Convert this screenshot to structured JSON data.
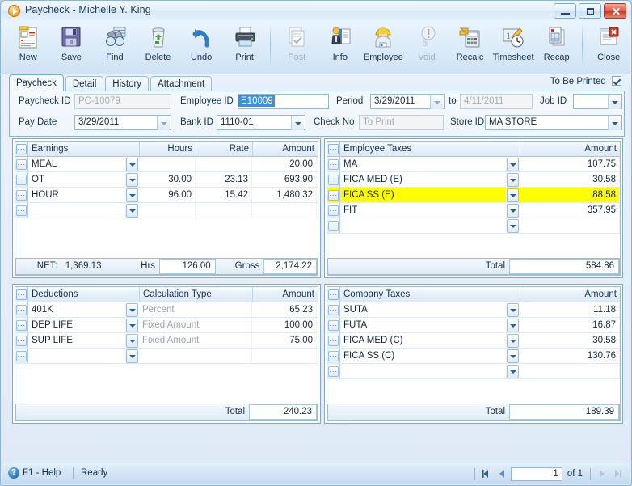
{
  "window": {
    "title": "Paycheck - Michelle Y. King",
    "icon": "play-circle-icon",
    "buttons": {
      "minimize": "minimize",
      "maximize": "maximize",
      "close": "close"
    }
  },
  "toolbar": [
    {
      "label": "New",
      "icon": "new-document-icon",
      "disabled": false
    },
    {
      "label": "Save",
      "icon": "floppy-disk-icon",
      "disabled": false
    },
    {
      "label": "Find",
      "icon": "binoculars-icon",
      "disabled": false
    },
    {
      "label": "Delete",
      "icon": "trash-can-icon",
      "disabled": false
    },
    {
      "label": "Undo",
      "icon": "undo-arrow-icon",
      "disabled": false
    },
    {
      "label": "Print",
      "icon": "printer-icon",
      "disabled": false
    },
    {
      "label": "Post",
      "icon": "post-pages-icon",
      "disabled": true
    },
    {
      "label": "Info",
      "icon": "info-person-icon",
      "disabled": false
    },
    {
      "label": "Employee",
      "icon": "employee-icon",
      "disabled": false
    },
    {
      "label": "Void",
      "icon": "void-dollar-icon",
      "disabled": true
    },
    {
      "label": "Recalc",
      "icon": "calculator-icon",
      "disabled": false
    },
    {
      "label": "Timesheet",
      "icon": "timesheet-clock-icon",
      "disabled": false
    },
    {
      "label": "Recap",
      "icon": "recap-report-icon",
      "disabled": false
    },
    {
      "label": "Close",
      "icon": "close-window-icon",
      "disabled": false
    }
  ],
  "tabs": [
    {
      "label": "Paycheck",
      "active": true
    },
    {
      "label": "Detail",
      "active": false
    },
    {
      "label": "History",
      "active": false
    },
    {
      "label": "Attachment",
      "active": false
    }
  ],
  "to_be_printed": {
    "label": "To Be Printed",
    "checked": true
  },
  "form": {
    "paycheck_id": {
      "label": "Paycheck ID",
      "value": "PC-10079",
      "readonly": true
    },
    "employee_id": {
      "label": "Employee ID",
      "value": "E10009",
      "selected": true
    },
    "period": {
      "label": "Period",
      "value": "3/29/2011"
    },
    "period_to": {
      "label": "to",
      "value": "4/11/2011",
      "readonly": true
    },
    "job_id": {
      "label": "Job ID",
      "value": ""
    },
    "pay_date": {
      "label": "Pay Date",
      "value": "3/29/2011"
    },
    "bank_id": {
      "label": "Bank ID",
      "value": "1110-01"
    },
    "check_no": {
      "label": "Check No",
      "value": "",
      "placeholder": "To Print",
      "readonly": true
    },
    "store_id": {
      "label": "Store ID",
      "value": "MA STORE"
    }
  },
  "earnings": {
    "columns": [
      "Earnings",
      "Hours",
      "Rate",
      "Amount"
    ],
    "rows": [
      {
        "name": "MEAL",
        "hours": "",
        "rate": "",
        "amount": "20.00"
      },
      {
        "name": "OT",
        "hours": "30.00",
        "rate": "23.13",
        "amount": "693.90"
      },
      {
        "name": "HOUR",
        "hours": "96.00",
        "rate": "15.42",
        "amount": "1,480.32"
      },
      {
        "name": "",
        "hours": "",
        "rate": "",
        "amount": ""
      }
    ],
    "footer": {
      "net_label": "NET:",
      "net_value": "1,369.13",
      "hrs_label": "Hrs",
      "hrs_value": "126.00",
      "gross_label": "Gross",
      "gross_value": "2,174.22"
    }
  },
  "employee_taxes": {
    "columns": [
      "Employee Taxes",
      "Amount"
    ],
    "rows": [
      {
        "name": "MA",
        "amount": "107.75",
        "highlight": false
      },
      {
        "name": "FICA MED (E)",
        "amount": "30.58",
        "highlight": false
      },
      {
        "name": "FICA SS (E)",
        "amount": "88.58",
        "highlight": true
      },
      {
        "name": "FIT",
        "amount": "357.95",
        "highlight": false
      },
      {
        "name": "",
        "amount": "",
        "highlight": false
      }
    ],
    "footer": {
      "label": "Total",
      "value": "584.86"
    }
  },
  "deductions": {
    "columns": [
      "Deductions",
      "Calculation Type",
      "Amount"
    ],
    "rows": [
      {
        "name": "401K",
        "calc": "Percent",
        "amount": "65.23"
      },
      {
        "name": "DEP LIFE",
        "calc": "Fixed Amount",
        "amount": "100.00"
      },
      {
        "name": "SUP LIFE",
        "calc": "Fixed Amount",
        "amount": "75.00"
      },
      {
        "name": "",
        "calc": "",
        "amount": ""
      }
    ],
    "footer": {
      "label": "Total",
      "value": "240.23"
    }
  },
  "company_taxes": {
    "columns": [
      "Company Taxes",
      "Amount"
    ],
    "rows": [
      {
        "name": "SUTA",
        "amount": "11.18"
      },
      {
        "name": "FUTA",
        "amount": "16.87"
      },
      {
        "name": "FICA MED (C)",
        "amount": "30.58"
      },
      {
        "name": "FICA SS (C)",
        "amount": "130.76"
      },
      {
        "name": "",
        "amount": ""
      }
    ],
    "footer": {
      "label": "Total",
      "value": "189.39"
    }
  },
  "statusbar": {
    "help": "F1 - Help",
    "status": "Ready",
    "page_current": "1",
    "of_label": "of 1",
    "nav": {
      "first": "first-record",
      "prev": "previous-record",
      "next": "next-record",
      "last": "last-record"
    }
  },
  "colors": {
    "highlight_row": "#ffff00",
    "selection": "#3f8fd8",
    "accent": "#16324f",
    "close_button": "#c93a23"
  }
}
